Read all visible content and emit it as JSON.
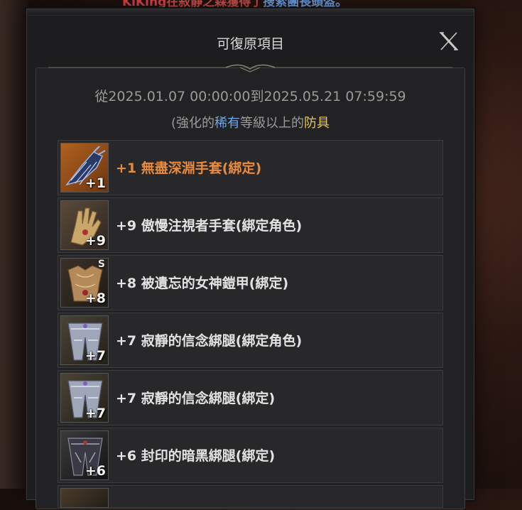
{
  "ticker": {
    "player": "KiKing",
    "middle": "在寂靜之森獲得了",
    "item": "搜索團長頭盔。"
  },
  "dialog": {
    "title": "可復原項目",
    "close_icon": "close-x-icon",
    "date_range": "從2025.01.07 00:00:00到2025.05.21 07:59:59",
    "condition": {
      "open": "(強化的",
      "rarity": "稀有",
      "middle": "等級以上的",
      "category": "防具"
    },
    "colors": {
      "rarity": "#6aa7f0",
      "category": "#e9c74c",
      "first_item": "#e98a3c"
    }
  },
  "items": [
    {
      "name": "+1 無盡深淵手套(綁定)",
      "level": "+1",
      "s": "",
      "icon": "abyss-gauntlet-icon"
    },
    {
      "name": "+9 傲慢注視者手套(綁定角色)",
      "level": "+9",
      "s": "",
      "icon": "golden-glove-icon"
    },
    {
      "name": "+8 被遺忘的女神鎧甲(綁定)",
      "level": "+8",
      "s": "S",
      "icon": "goddess-armor-icon"
    },
    {
      "name": "+7 寂靜的信念綁腿(綁定角色)",
      "level": "+7",
      "s": "",
      "icon": "silent-leggings-icon"
    },
    {
      "name": "+7 寂靜的信念綁腿(綁定)",
      "level": "+7",
      "s": "",
      "icon": "silent-leggings-icon"
    },
    {
      "name": "+6 封印的暗黑綁腿(綁定)",
      "level": "+6",
      "s": "",
      "icon": "dark-leggings-icon"
    }
  ]
}
